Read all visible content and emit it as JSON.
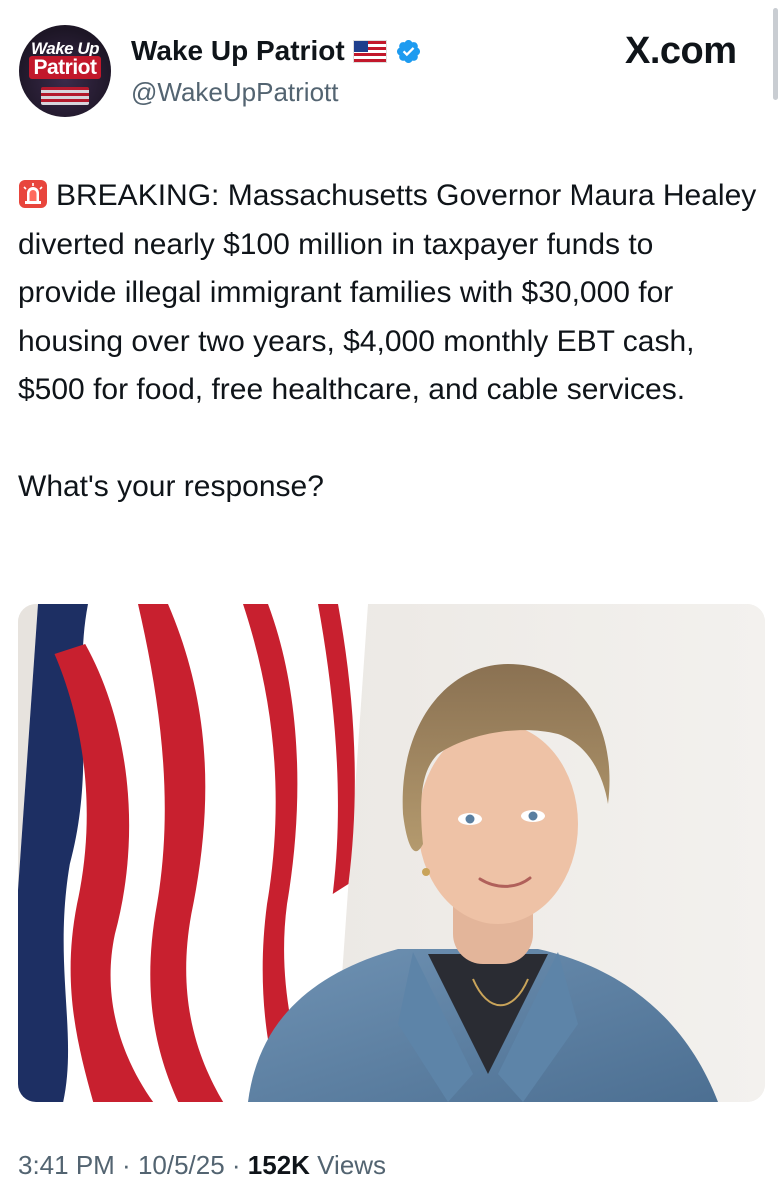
{
  "account": {
    "avatar_line1": "Wake Up",
    "avatar_line2": "Patriot",
    "display_name": "Wake Up Patriot",
    "flag_icon": "us-flag-icon",
    "verified_icon": "verified-badge-icon",
    "handle": "@WakeUpPatriott"
  },
  "brand": {
    "site": "X.com"
  },
  "tweet": {
    "emoji_icon": "police-siren-icon",
    "text": "BREAKING: Massachusetts Governor Maura Healey diverted nearly $100 million in taxpayer funds to provide illegal immigrant families with $30,000 for housing over two years, $4,000 monthly EBT cash, $500 for food, free healthcare, and cable services.\n\nWhat's your response?"
  },
  "media": {
    "description_icon": "photo-image"
  },
  "meta": {
    "time": "3:41 PM",
    "sep1": " · ",
    "date": "10/5/25",
    "sep2": " · ",
    "views_count": "152K",
    "views_label": " Views"
  },
  "colors": {
    "verified": "#1d9bf0",
    "secondary_text": "#536471",
    "primary_text": "#0f1419"
  }
}
